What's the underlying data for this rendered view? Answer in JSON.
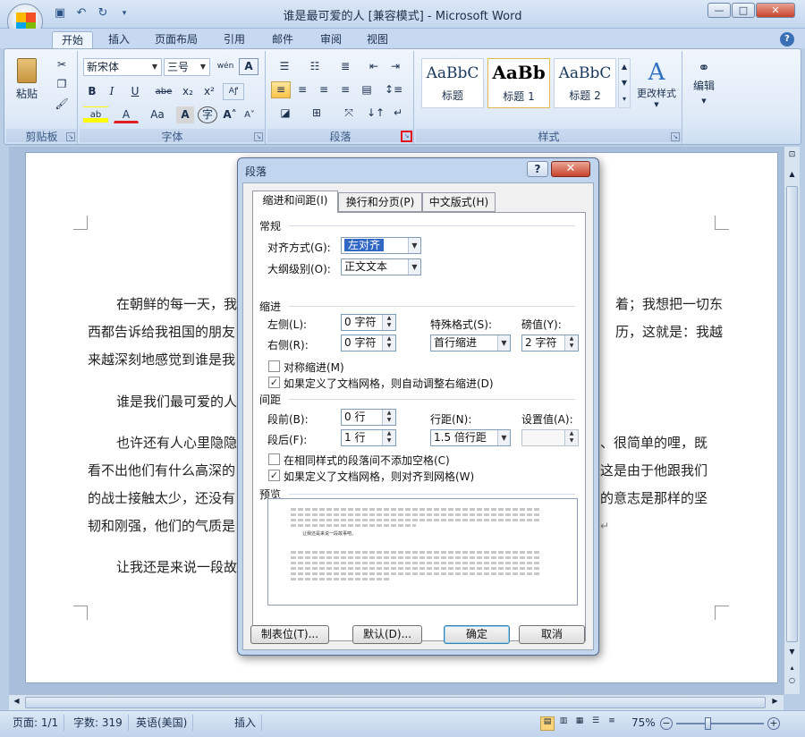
{
  "window": {
    "title": "谁是最可爱的人 [兼容模式] - Microsoft Word"
  },
  "quick_access": [
    "save-icon",
    "undo-icon",
    "redo-icon"
  ],
  "ribbon_tabs": [
    {
      "label": "开始"
    },
    {
      "label": "插入"
    },
    {
      "label": "页面布局"
    },
    {
      "label": "引用"
    },
    {
      "label": "邮件"
    },
    {
      "label": "审阅"
    },
    {
      "label": "视图"
    }
  ],
  "ribbon": {
    "clipboard": {
      "paste": "粘贴",
      "label": "剪贴板"
    },
    "font": {
      "name": "新宋体",
      "size": "三号",
      "label": "字体",
      "bold": "B",
      "italic": "I",
      "underline": "U",
      "strike": "abe",
      "sub": "x₂",
      "sup": "x²",
      "grow": "A",
      "case": "Aa"
    },
    "paragraph": {
      "label": "段落"
    },
    "styles": {
      "label": "样式",
      "items": [
        {
          "sample": "AaBbC",
          "name": "标题"
        },
        {
          "sample": "AaBb",
          "name": "标题 1"
        },
        {
          "sample": "AaBbC",
          "name": "标题 2"
        }
      ],
      "change": "更改样式"
    },
    "edit": {
      "label": "编辑"
    }
  },
  "document": {
    "paragraphs": [
      {
        "l1": "在朝鲜的每一天，我",
        "l1r": "着；我想把一切东"
      },
      {
        "l1": "西都告诉给我祖国的朋友",
        "l1r": "历，这就是：我越"
      },
      {
        "l1": "来越深刻地感觉到谁是我"
      },
      {
        "l1": "谁是我们最可爱的人"
      },
      {
        "l1": "也许还有人心里隐隐",
        "l1r": "、很简单的哩，既"
      },
      {
        "l1": "看不出他们有什么高深的",
        "l1r": "这是由于他跟我们"
      },
      {
        "l1": "的战士接触太少，还没有",
        "l1r": "的意志是那样的坚"
      },
      {
        "l1": "韧和刚强，他们的气质是"
      },
      {
        "l1": "让我还是来说一段故"
      }
    ]
  },
  "dialog": {
    "title": "段落",
    "tabs": [
      {
        "label": "缩进和间距(I)"
      },
      {
        "label": "换行和分页(P)"
      },
      {
        "label": "中文版式(H)"
      }
    ],
    "general": {
      "heading": "常规",
      "alignment_label": "对齐方式(G):",
      "alignment_value": "左对齐",
      "outline_label": "大纲级别(O):",
      "outline_value": "正文文本"
    },
    "indent": {
      "heading": "缩进",
      "left_label": "左侧(L):",
      "left_value": "0 字符",
      "right_label": "右侧(R):",
      "right_value": "0 字符",
      "special_label": "特殊格式(S):",
      "special_value": "首行缩进",
      "by_label": "磅值(Y):",
      "by_value": "2 字符",
      "mirror_label": "对称缩进(M)",
      "auto_adjust_label": "如果定义了文档网格，则自动调整右缩进(D)"
    },
    "spacing": {
      "heading": "间距",
      "before_label": "段前(B):",
      "before_value": "0 行",
      "after_label": "段后(F):",
      "after_value": "1 行",
      "line_label": "行距(N):",
      "line_value": "1.5 倍行距",
      "at_label": "设置值(A):",
      "at_value": "",
      "no_space_label": "在相同样式的段落间不添加空格(C)",
      "snap_label": "如果定义了文档网格，则对齐到网格(W)"
    },
    "preview": {
      "heading": "预览",
      "sample_text": "让我还是来说一段故事吧。"
    },
    "buttons": {
      "tabs": "制表位(T)...",
      "default": "默认(D)...",
      "ok": "确定",
      "cancel": "取消"
    }
  },
  "status": {
    "page": "页面: 1/1",
    "words": "字数: 319",
    "language": "英语(美国)",
    "mode": "插入",
    "zoom": "75%"
  }
}
